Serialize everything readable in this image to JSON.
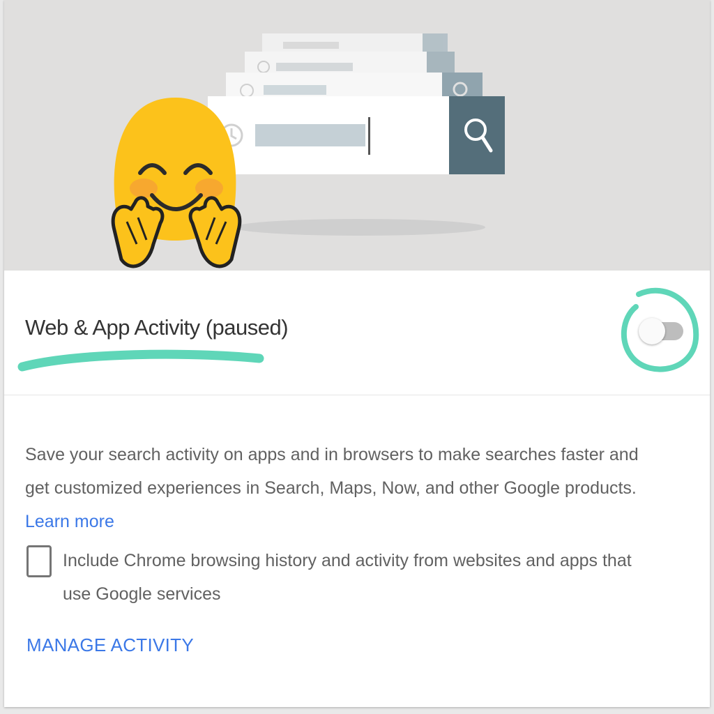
{
  "activity": {
    "title": "Web & App Activity (paused)",
    "toggle_state": "off",
    "description": "Save your search activity on apps and in browsers to make searches faster and get customized experiences in Search, Maps, Now, and other Google products.",
    "learn_more": "Learn more",
    "checkbox_checked": false,
    "checkbox_label": "Include Chrome browsing history and activity from websites and apps that use Google services",
    "manage_label": "MANAGE ACTIVITY"
  },
  "colors": {
    "accent_link": "#3b78e7",
    "highlight_marker": "#5fd6b8",
    "emoji_yellow": "#fcc21b",
    "search_button": "#546e7a"
  },
  "icons": [
    "hugging-face-emoji",
    "search-icon",
    "history-clock-icon"
  ]
}
